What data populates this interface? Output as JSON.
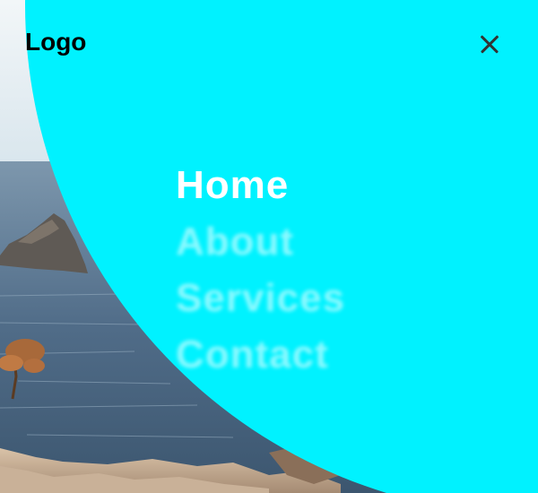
{
  "brand": {
    "logo_text": "Logo",
    "overlay_color": "#00f2ff"
  },
  "header": {
    "close_icon": "close-icon"
  },
  "menu": {
    "items": [
      {
        "label": "Home",
        "active": true
      },
      {
        "label": "About",
        "active": false
      },
      {
        "label": "Services",
        "active": false
      },
      {
        "label": "Contact",
        "active": false
      }
    ]
  },
  "background": {
    "description_icon": "coastal-landscape-photo"
  }
}
